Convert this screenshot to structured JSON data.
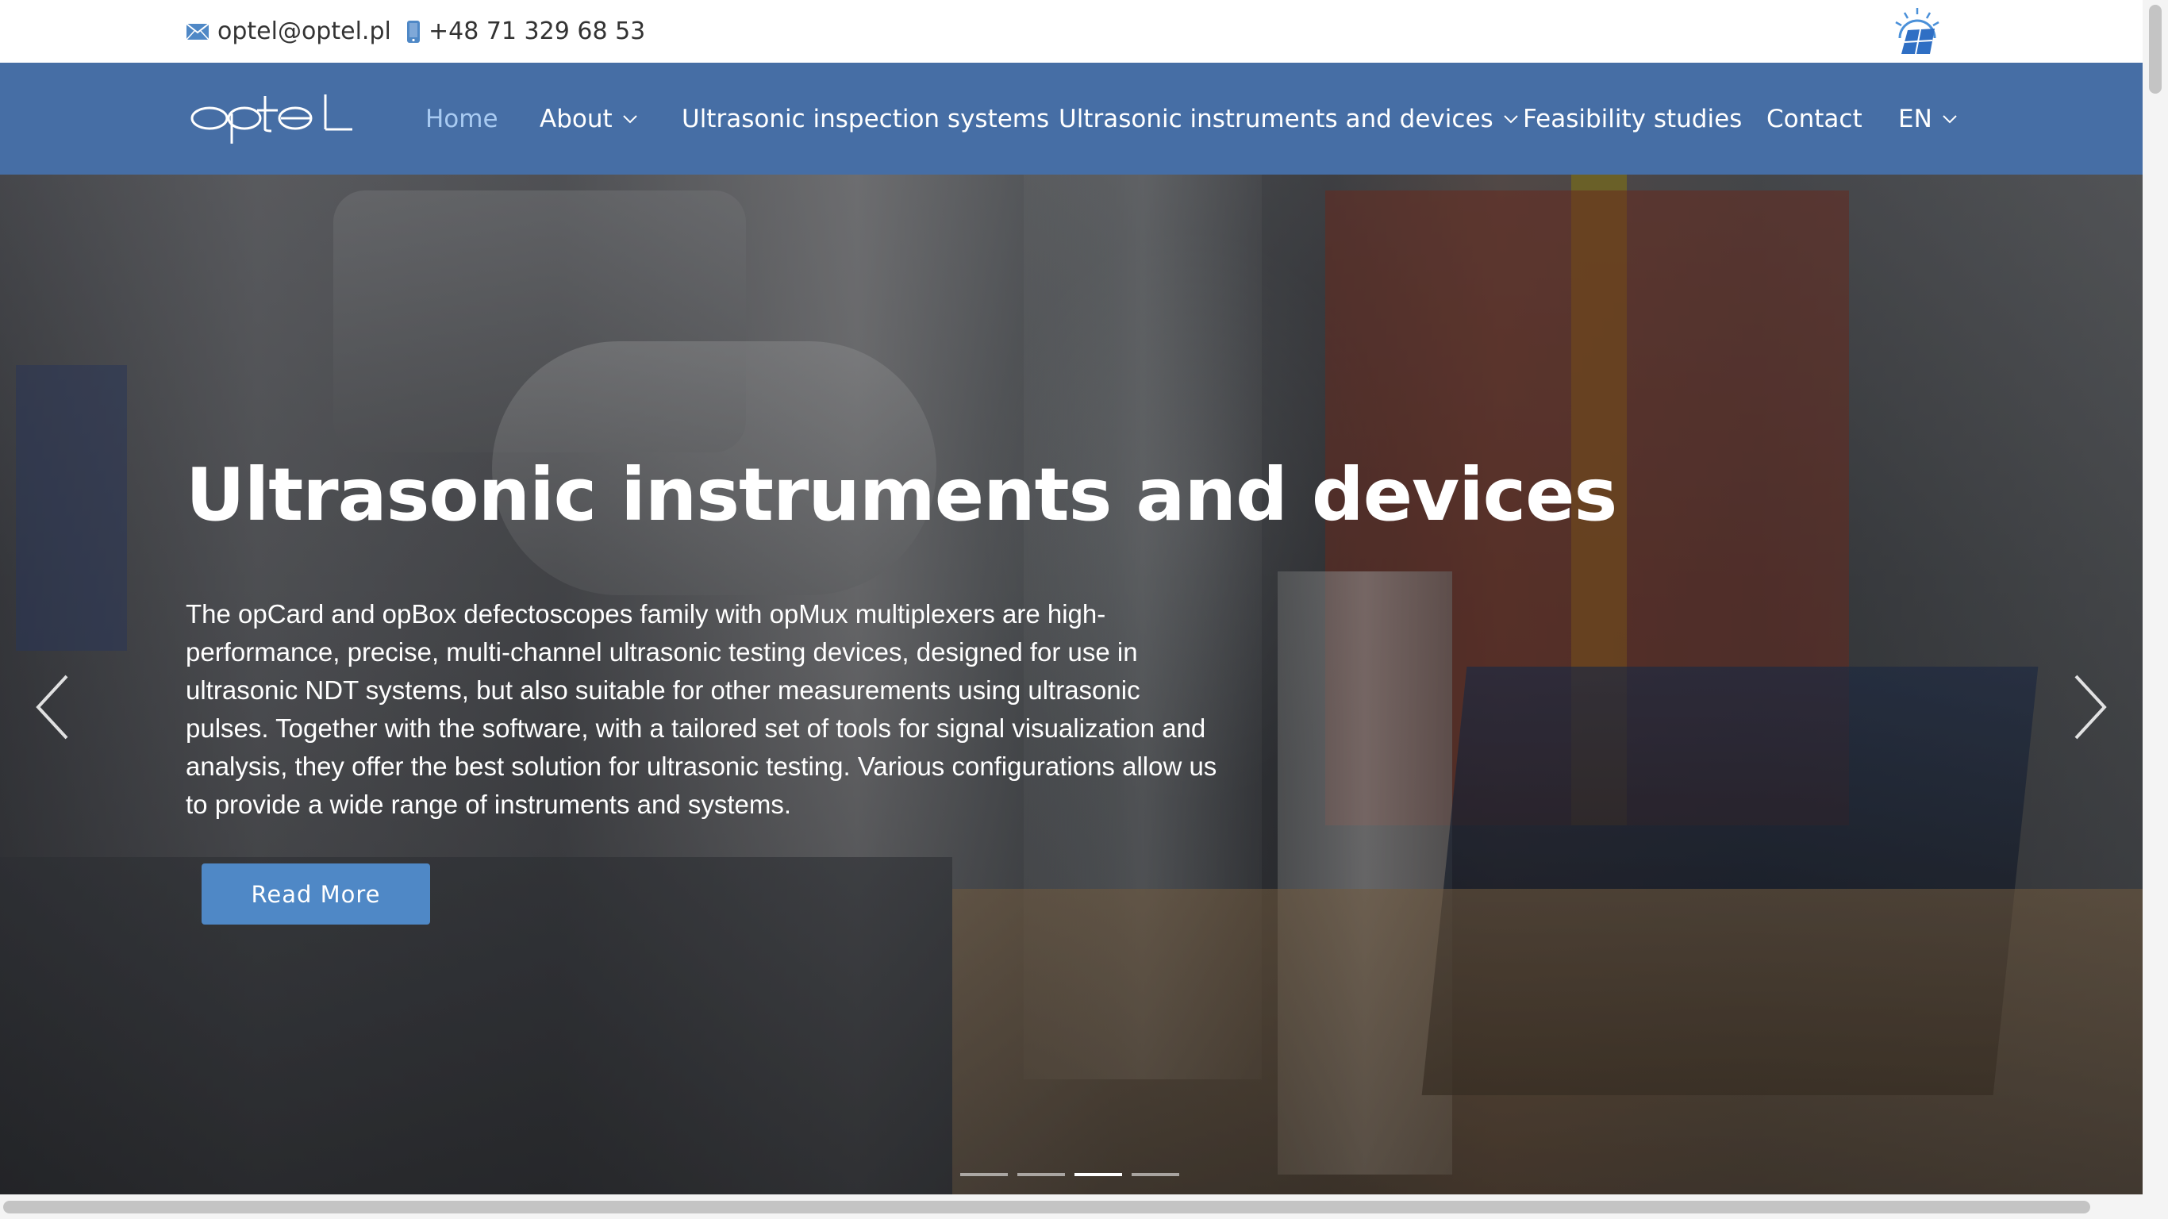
{
  "topbar": {
    "email": "optel@optel.pl",
    "phone": "+48 71 329 68 53",
    "email_icon": "envelope-icon",
    "phone_icon": "mobile-phone-icon",
    "badge_icon": "sun-solar-panel-icon"
  },
  "navbar": {
    "logo_text": "optel",
    "items": [
      {
        "label": "Home",
        "active": true,
        "dropdown": false
      },
      {
        "label": "About",
        "active": false,
        "dropdown": true
      },
      {
        "label": "Ultrasonic inspection systems",
        "active": false,
        "dropdown": false
      },
      {
        "label": "Ultrasonic instruments and devices",
        "active": false,
        "dropdown": true
      },
      {
        "label": "Feasibility studies",
        "active": false,
        "dropdown": false
      },
      {
        "label": "Contact",
        "active": false,
        "dropdown": false
      },
      {
        "label": "EN",
        "active": false,
        "dropdown": true
      }
    ]
  },
  "hero": {
    "title": "Ultrasonic instruments and devices",
    "lines": [
      "The opCard and opBox defectoscopes family with opMux multiplexers are high-",
      "performance, precise, multi-channel ultrasonic testing devices, designed for use in",
      "ultrasonic NDT systems, but also suitable for other measurements using ultrasonic",
      "pulses. Together with the software, with a tailored set of tools for signal visualization and",
      "analysis, they offer the best solution for ultrasonic testing. Various configurations allow us",
      "to provide a wide range of instruments and systems."
    ],
    "button_label": "Read More",
    "slide_count": 4,
    "active_slide": 3
  },
  "colors": {
    "nav_bg": "#466ea5",
    "active_nav": "#a9cbf2",
    "button_bg": "#4f88c6"
  }
}
